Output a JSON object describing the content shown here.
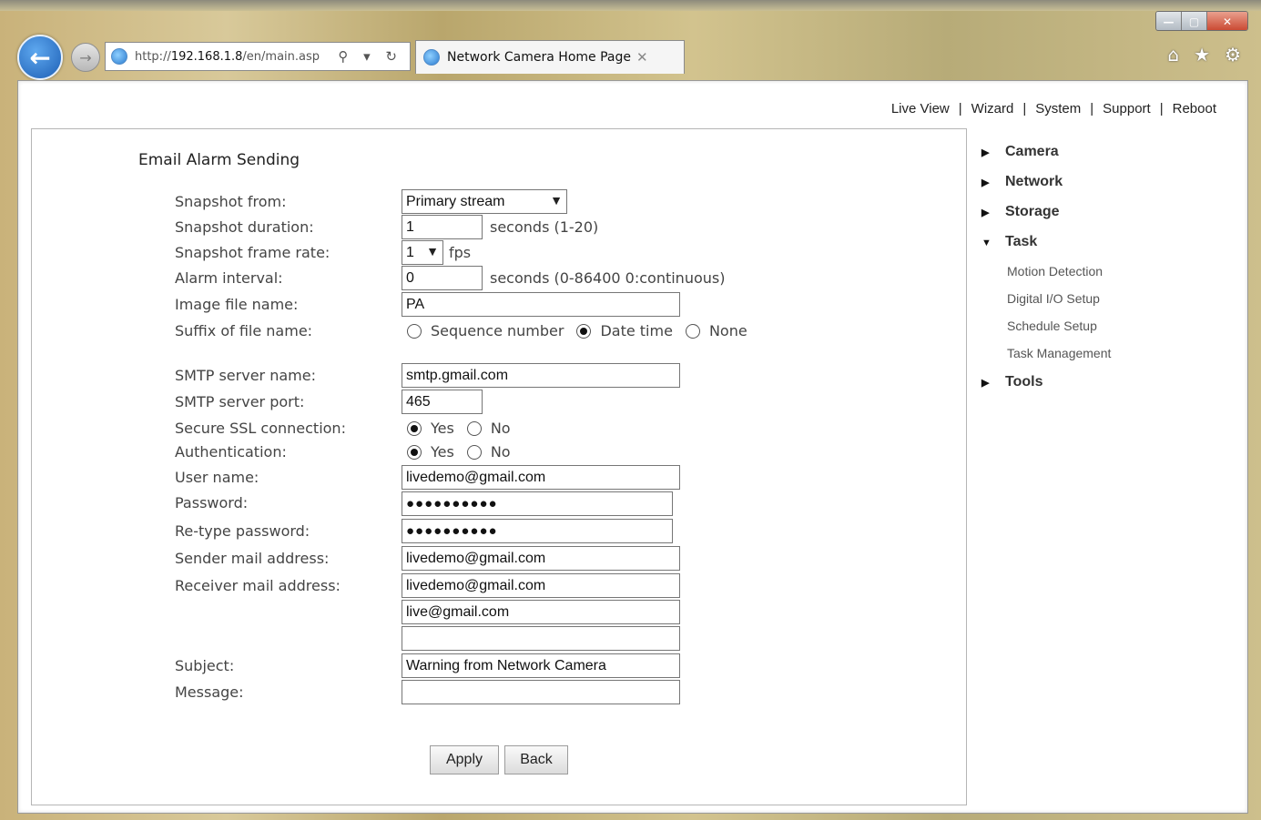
{
  "browser": {
    "address_prefix": "http://",
    "address_host": "192.168.1.8",
    "address_path": "/en/main.asp",
    "tab_title": "Network Camera Home Page",
    "tab_close": "✕",
    "win_minimize": "—",
    "win_maximize": "▢",
    "win_close": "✕",
    "back_glyph": "←",
    "forward_glyph": "→",
    "search_refresh_glyphs": "⚲ ▾ ↻",
    "home_glyph": "⌂",
    "favorites_glyph": "★",
    "settings_glyph": "⚙"
  },
  "topnav": {
    "items": [
      "Live View",
      "Wizard",
      "System",
      "Support",
      "Reboot"
    ],
    "separator": "|"
  },
  "form": {
    "title": "Email Alarm Sending",
    "labels": {
      "snapshot_from": "Snapshot from:",
      "snapshot_duration": "Snapshot duration:",
      "snapshot_frame_rate": "Snapshot frame rate:",
      "alarm_interval": "Alarm interval:",
      "image_file_name": "Image file name:",
      "suffix": "Suffix of file name:",
      "smtp_server_name": "SMTP server name:",
      "smtp_server_port": "SMTP server port:",
      "secure_ssl": "Secure SSL connection:",
      "authentication": "Authentication:",
      "user_name": "User name:",
      "password": "Password:",
      "retype_password": "Re-type password:",
      "sender": "Sender mail address:",
      "receiver": "Receiver mail address:",
      "subject": "Subject:",
      "message": "Message:"
    },
    "values": {
      "snapshot_from": "Primary stream",
      "snapshot_duration": "1",
      "snapshot_duration_unit": "seconds (1-20)",
      "frame_rate": "1",
      "frame_rate_unit": "fps",
      "alarm_interval": "0",
      "alarm_interval_unit": "seconds (0-86400 0:continuous)",
      "image_file_name": "PA",
      "smtp_server_name": "smtp.gmail.com",
      "smtp_server_port": "465",
      "user_name": "livedemo@gmail.com",
      "password": "●●●●●●●●●●",
      "retype_password": "●●●●●●●●●●",
      "sender": "livedemo@gmail.com",
      "receiver_1": "livedemo@gmail.com",
      "receiver_2": "live@gmail.com",
      "receiver_3": "",
      "subject": "Warning from Network Camera",
      "message": ""
    },
    "suffix_options": [
      "Sequence number",
      "Date time",
      "None"
    ],
    "suffix_selected": "Date time",
    "yes_label": "Yes",
    "no_label": "No",
    "ssl_selected": "Yes",
    "auth_selected": "Yes",
    "chevron": "▼",
    "buttons": {
      "apply": "Apply",
      "back": "Back"
    }
  },
  "sidemenu": {
    "collapsed_glyph": "▶",
    "expanded_glyph": "▼",
    "items": [
      {
        "label": "Camera",
        "expanded": false
      },
      {
        "label": "Network",
        "expanded": false
      },
      {
        "label": "Storage",
        "expanded": false
      },
      {
        "label": "Task",
        "expanded": true
      },
      {
        "label": "Tools",
        "expanded": false
      }
    ],
    "task_subitems": [
      "Motion Detection",
      "Digital I/O Setup",
      "Schedule Setup",
      "Task Management"
    ]
  }
}
